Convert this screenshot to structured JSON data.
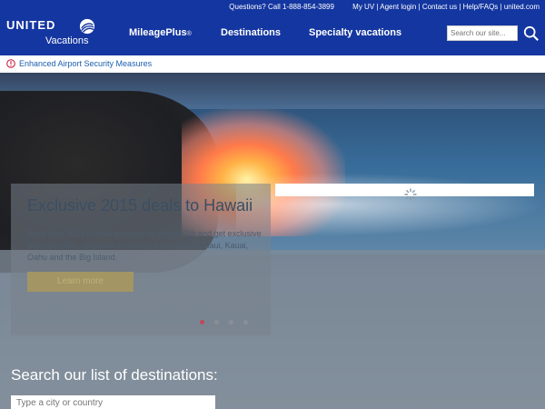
{
  "header": {
    "utility_links": [
      "Questions? Call 1-888-854-3899",
      "My UV",
      "Agent login",
      "Contact us",
      "Help/FAQs",
      "united.com"
    ],
    "logo_top": "UNITED",
    "logo_bottom": "Vacations",
    "nav": [
      {
        "label": "MileagePlus",
        "suffix": "®"
      },
      {
        "label": "Destinations"
      },
      {
        "label": "Specialty vacations"
      }
    ],
    "search_placeholder": "Search our site..."
  },
  "alert": {
    "label": "Enhanced Airport Security Measures"
  },
  "hero": {
    "title": "Exclusive 2015 deals to Hawaii",
    "body": "Book your 2015 Hawaii getaway by August 7th and get exclusive reduced rates, upgrades and more to resorts on Maui, Kauai, Oahu and the Big Island.",
    "button": "Learn more"
  },
  "destinations": {
    "title": "Search our list of destinations:",
    "placeholder": "Type a city or country"
  },
  "colors": {
    "brand": "#1436a0",
    "alert_icon": "#c8102e",
    "link": "#1c5fb0"
  }
}
